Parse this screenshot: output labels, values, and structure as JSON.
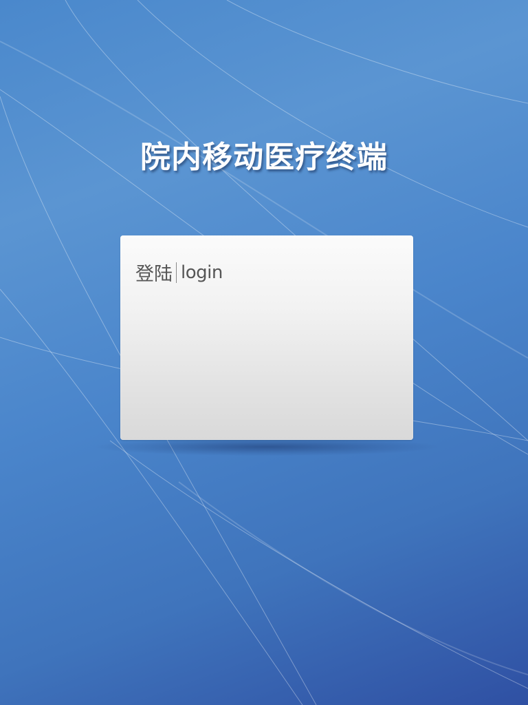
{
  "app": {
    "title": "院内移动医疗终端"
  },
  "login": {
    "heading_cn": "登陆",
    "heading_en": "login"
  },
  "colors": {
    "background_top": "#4a88cc",
    "background_bottom": "#2f50a3",
    "card_top": "#fbfbfb",
    "card_bottom": "#d9d9d9",
    "heading_text": "#555555",
    "title_text": "#ffffff"
  }
}
